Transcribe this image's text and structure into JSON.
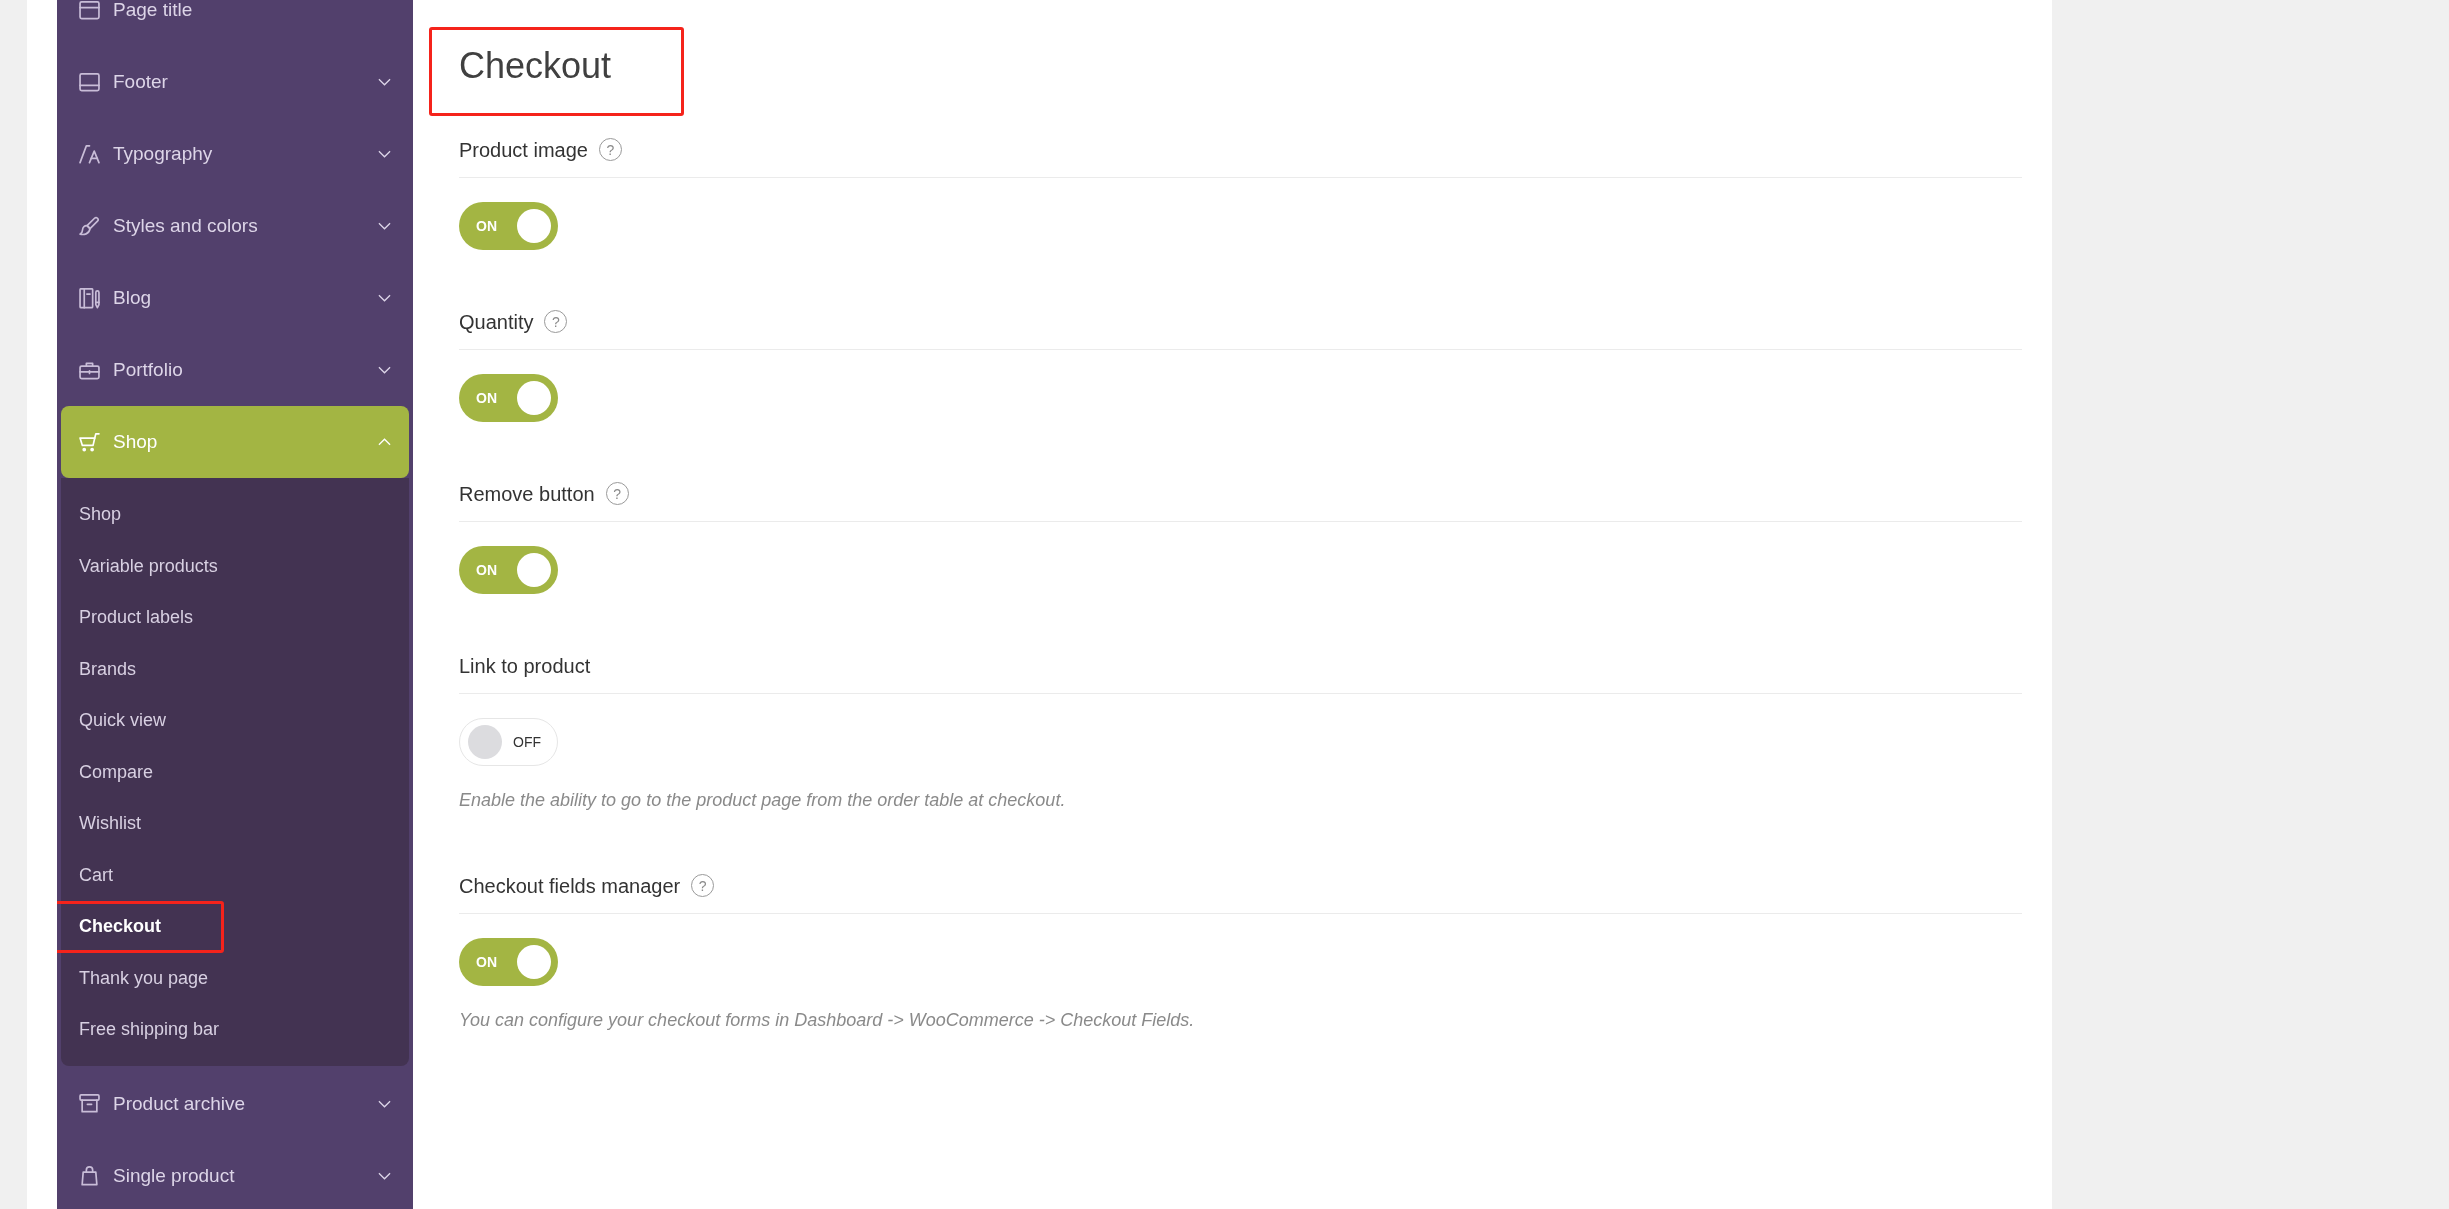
{
  "sidebar": {
    "items": [
      {
        "label": "Page title",
        "kind": "page",
        "selected": false
      },
      {
        "label": "Footer",
        "kind": "group",
        "selected": false,
        "expanded": false
      },
      {
        "label": "Typography",
        "kind": "group",
        "selected": false,
        "expanded": false
      },
      {
        "label": "Styles and colors",
        "kind": "group",
        "selected": false,
        "expanded": false
      },
      {
        "label": "Blog",
        "kind": "group",
        "selected": false,
        "expanded": false
      },
      {
        "label": "Portfolio",
        "kind": "group",
        "selected": false,
        "expanded": false
      },
      {
        "label": "Shop",
        "kind": "group",
        "selected": true,
        "expanded": true,
        "children": [
          {
            "label": "Shop",
            "selected": false,
            "highlighted": false
          },
          {
            "label": "Variable products",
            "selected": false,
            "highlighted": false
          },
          {
            "label": "Product labels",
            "selected": false,
            "highlighted": false
          },
          {
            "label": "Brands",
            "selected": false,
            "highlighted": false
          },
          {
            "label": "Quick view",
            "selected": false,
            "highlighted": false
          },
          {
            "label": "Compare",
            "selected": false,
            "highlighted": false
          },
          {
            "label": "Wishlist",
            "selected": false,
            "highlighted": false
          },
          {
            "label": "Cart",
            "selected": false,
            "highlighted": false
          },
          {
            "label": "Checkout",
            "selected": true,
            "highlighted": true
          },
          {
            "label": "Thank you page",
            "selected": false,
            "highlighted": false
          },
          {
            "label": "Free shipping bar",
            "selected": false,
            "highlighted": false
          }
        ]
      },
      {
        "label": "Product archive",
        "kind": "group",
        "selected": false,
        "expanded": false
      },
      {
        "label": "Single product",
        "kind": "group",
        "selected": false,
        "expanded": false
      }
    ]
  },
  "main": {
    "heading": {
      "text": "Checkout",
      "highlighted": true
    },
    "sections": [
      {
        "label": "Product image",
        "help": "?",
        "toggle": {
          "on": true,
          "text": "ON"
        }
      },
      {
        "label": "Quantity",
        "help": "?",
        "toggle": {
          "on": true,
          "text": "ON"
        }
      },
      {
        "label": "Remove button",
        "help": "?",
        "toggle": {
          "on": true,
          "text": "ON"
        }
      },
      {
        "label": "Link to product",
        "toggle": {
          "on": false,
          "text": "OFF"
        },
        "description": "Enable the ability to go to the product page from the order table at checkout."
      },
      {
        "label": "Checkout fields manager",
        "help": "?",
        "toggle": {
          "on": true,
          "text": "ON"
        },
        "description": "You can configure your checkout forms in Dashboard -> WooCommerce -> Checkout Fields."
      }
    ]
  }
}
